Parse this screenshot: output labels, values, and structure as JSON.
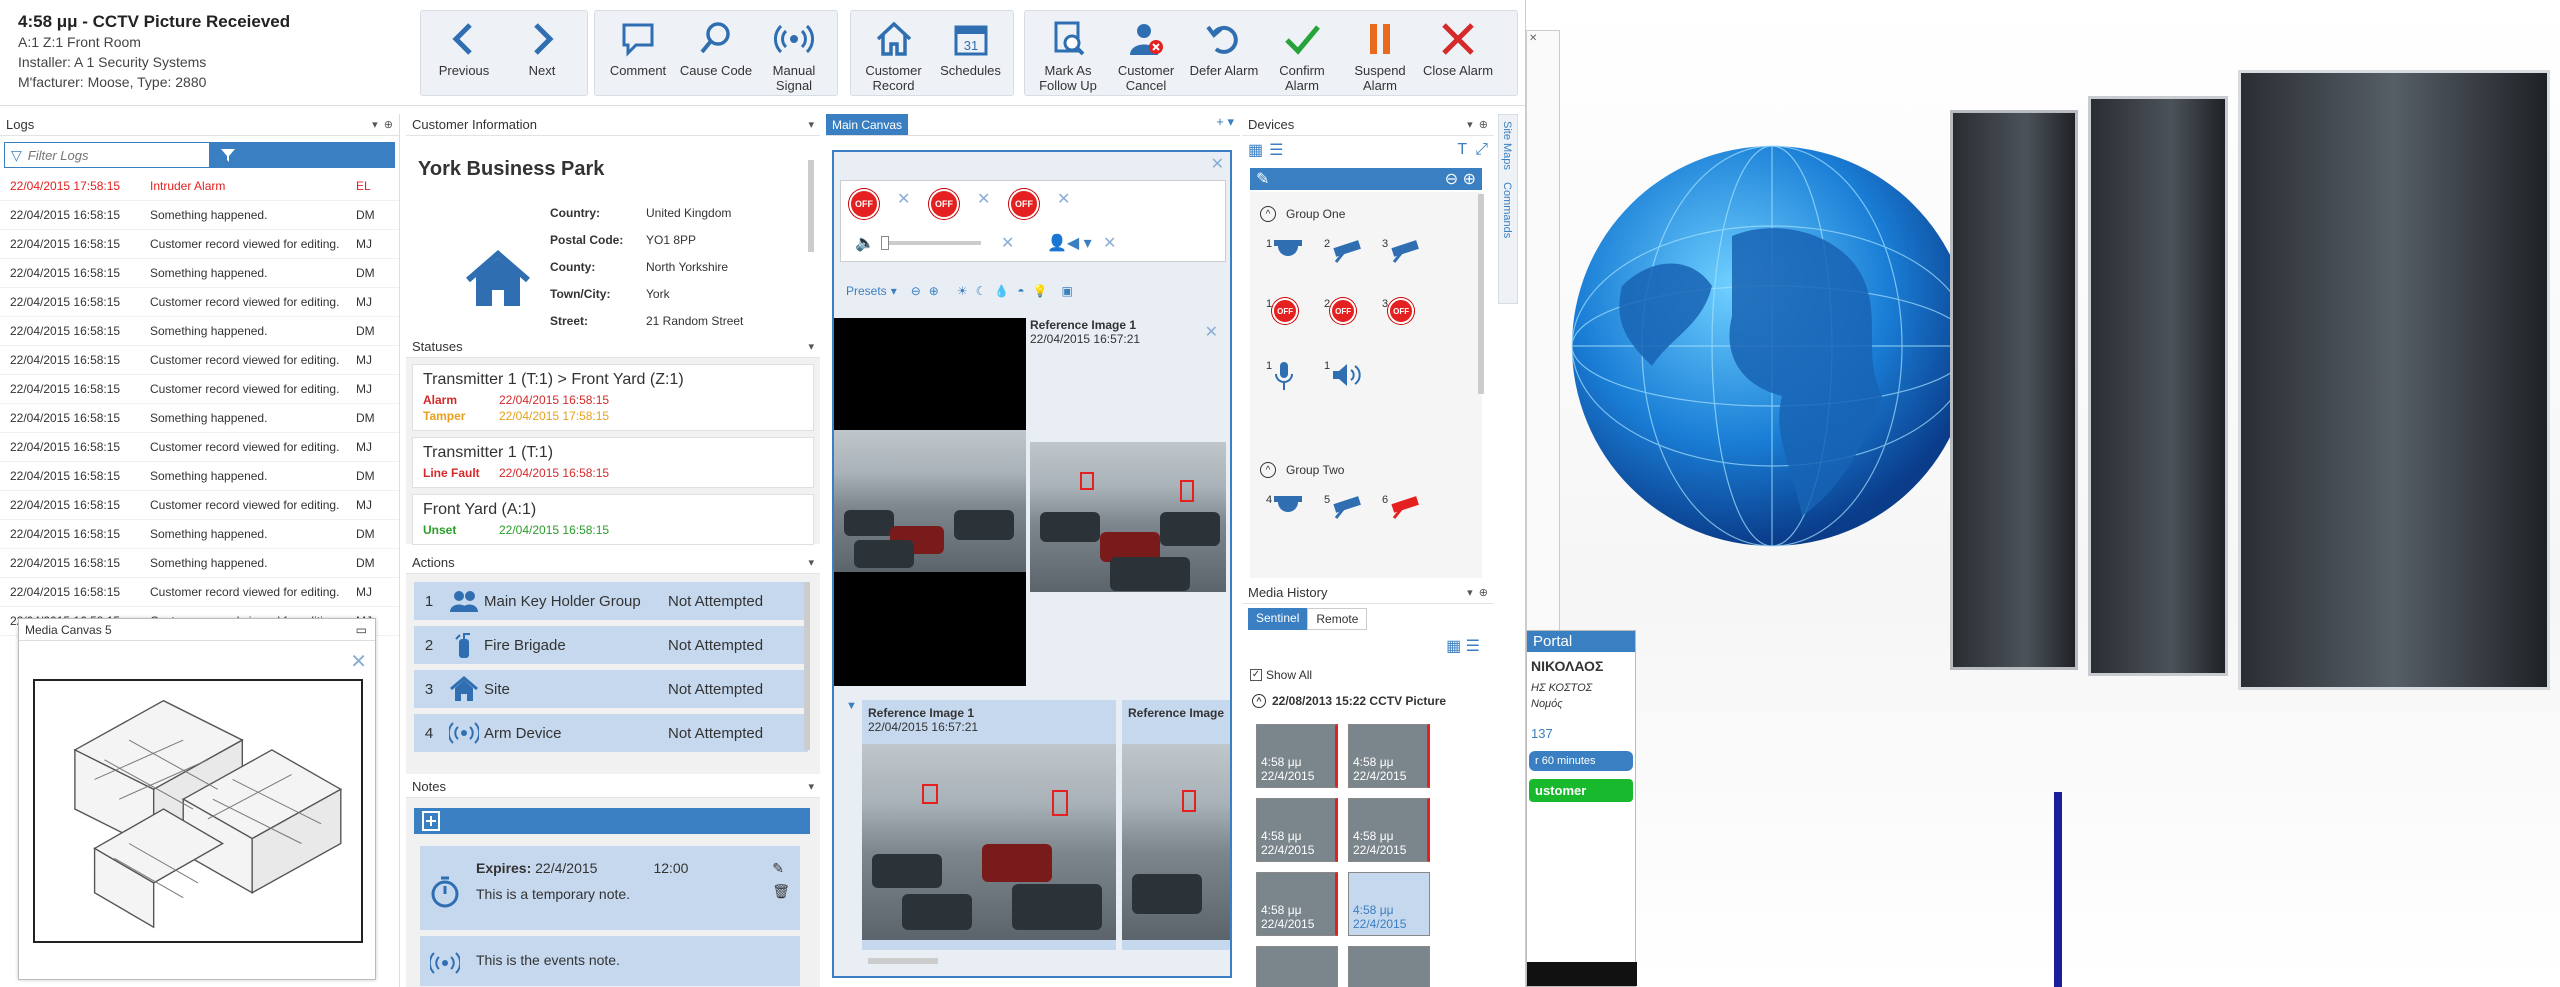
{
  "alarm": {
    "title": "4:58 μμ - CCTV Picture Receieved",
    "zone": "A:1 Z:1 Front Room",
    "installer": "Installer: A 1 Security Systems",
    "manufacturer": "M'facturer: Moose, Type: 2880"
  },
  "toolbar": {
    "previous": "Previous",
    "next": "Next",
    "comment": "Comment",
    "cause_code": "Cause Code",
    "manual_signal": "Manual Signal",
    "customer_record": "Customer Record",
    "schedules": "Schedules",
    "mark_follow_up": "Mark As Follow Up",
    "customer_cancel": "Customer Cancel",
    "defer_alarm": "Defer Alarm",
    "confirm_alarm": "Confirm Alarm",
    "suspend_alarm": "Suspend Alarm",
    "close_alarm": "Close Alarm"
  },
  "logs": {
    "title": "Logs",
    "filter_placeholder": "Filter Logs",
    "rows": [
      {
        "date": "22/04/2015 17:58:15",
        "msg": "Intruder Alarm",
        "user": "EL"
      },
      {
        "date": "22/04/2015 16:58:15",
        "msg": "Something happened.",
        "user": "DM"
      },
      {
        "date": "22/04/2015 16:58:15",
        "msg": "Customer record viewed for editing.",
        "user": "MJ"
      },
      {
        "date": "22/04/2015 16:58:15",
        "msg": "Something happened.",
        "user": "DM"
      },
      {
        "date": "22/04/2015 16:58:15",
        "msg": "Customer record viewed for editing.",
        "user": "MJ"
      },
      {
        "date": "22/04/2015 16:58:15",
        "msg": "Something happened.",
        "user": "DM"
      },
      {
        "date": "22/04/2015 16:58:15",
        "msg": "Customer record viewed for editing.",
        "user": "MJ"
      },
      {
        "date": "22/04/2015 16:58:15",
        "msg": "Customer record viewed for editing.",
        "user": "MJ"
      },
      {
        "date": "22/04/2015 16:58:15",
        "msg": "Something happened.",
        "user": "DM"
      },
      {
        "date": "22/04/2015 16:58:15",
        "msg": "Customer record viewed for editing.",
        "user": "MJ"
      },
      {
        "date": "22/04/2015 16:58:15",
        "msg": "Something happened.",
        "user": "DM"
      },
      {
        "date": "22/04/2015 16:58:15",
        "msg": "Customer record viewed for editing.",
        "user": "MJ"
      },
      {
        "date": "22/04/2015 16:58:15",
        "msg": "Something happened.",
        "user": "DM"
      },
      {
        "date": "22/04/2015 16:58:15",
        "msg": "Something happened.",
        "user": "DM"
      },
      {
        "date": "22/04/2015 16:58:15",
        "msg": "Customer record viewed for editing.",
        "user": "MJ"
      },
      {
        "date": "22/04/2015 16:58:15",
        "msg": "Customer record viewed for editing.",
        "user": "MJ"
      }
    ],
    "alarm_color": "#e42020"
  },
  "media_canvas_5": {
    "title": "Media Canvas 5"
  },
  "customer": {
    "title": "Customer Information",
    "name": "York Business Park",
    "fields": [
      {
        "k": "Country:",
        "v": "United Kingdom"
      },
      {
        "k": "Postal Code:",
        "v": "YO1 8PP"
      },
      {
        "k": "County:",
        "v": "North Yorkshire"
      },
      {
        "k": "Town/City:",
        "v": "York"
      },
      {
        "k": "Street:",
        "v": "21 Random Street"
      }
    ]
  },
  "statuses": {
    "title": "Statuses",
    "items": [
      {
        "head": "Transmitter 1 (T:1) > Front Yard (Z:1)",
        "rows": [
          {
            "k": "Alarm",
            "v": "22/04/2015 16:58:15",
            "c": "#d42a2a"
          },
          {
            "k": "Tamper",
            "v": "22/04/2015 17:58:15",
            "c": "#e8a01c"
          }
        ]
      },
      {
        "head": "Transmitter 1 (T:1)",
        "rows": [
          {
            "k": "Line Fault",
            "v": "22/04/2015 16:58:15",
            "c": "#d42a2a"
          }
        ]
      },
      {
        "head": "Front Yard (A:1)",
        "rows": [
          {
            "k": "Unset",
            "v": "22/04/2015 16:58:15",
            "c": "#2a9d2a"
          }
        ]
      }
    ]
  },
  "actions": {
    "title": "Actions",
    "items": [
      {
        "n": "1",
        "label": "Main Key Holder Group",
        "status": "Not Attempted",
        "icon": "people-icon"
      },
      {
        "n": "2",
        "label": "Fire Brigade",
        "status": "Not Attempted",
        "icon": "extinguisher-icon"
      },
      {
        "n": "3",
        "label": "Site",
        "status": "Not Attempted",
        "icon": "home-icon"
      },
      {
        "n": "4",
        "label": "Arm Device",
        "status": "Not Attempted",
        "icon": "signal-icon"
      }
    ]
  },
  "notes": {
    "title": "Notes",
    "expires_label": "Expires:",
    "expires_date": "22/4/2015",
    "expires_time": "12:00",
    "temp_note": "This is a temporary note.",
    "event_note": "This is the events note."
  },
  "main_canvas": {
    "tab": "Main Canvas",
    "off": "OFF",
    "presets": "Presets",
    "ref1_title": "Reference Image 1",
    "ref1_time": "22/04/2015 16:57:21",
    "ref2_title": "Reference Image 1",
    "ref2_time": "22/04/2015 16:57:21",
    "ref3_title": "Reference Image"
  },
  "devices": {
    "title": "Devices",
    "group1": "Group One",
    "group2": "Group Two",
    "side_tabs": [
      "Site Maps",
      "Commands"
    ]
  },
  "media_history": {
    "title": "Media History",
    "tab_sentinel": "Sentinel",
    "tab_remote": "Remote",
    "show_all": "Show All",
    "group": "22/08/2013 15:22 CCTV Picture",
    "thumb_time": "4:58 μμ",
    "thumb_date": "22/4/2015"
  },
  "bg": {
    "portal": "Portal",
    "name": "ΝΙΚΟΛΑΟΣ",
    "line1": "ΗΣ ΚΟΣΤΟΣ",
    "line2": "Νομός",
    "num": "137",
    "btn1": "r 60 minutes",
    "btn2": "ustomer"
  }
}
